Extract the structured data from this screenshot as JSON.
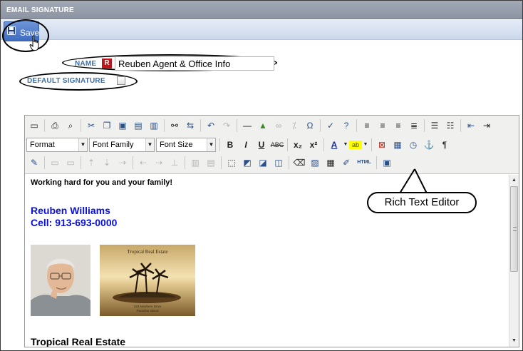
{
  "window": {
    "title": "EMAIL SIGNATURE"
  },
  "toolbar": {
    "save_label": "Save",
    "save_icon": "floppy-disk-icon"
  },
  "form": {
    "name_label": "NAME",
    "required_badge": "R",
    "name_value": "Reuben Agent & Office Info",
    "default_label": "DEFAULT SIGNATURE",
    "default_checked": false
  },
  "editor": {
    "format_label": "Format",
    "font_family_label": "Font Family",
    "font_size_label": "Font Size",
    "html_label": "HTML",
    "content": {
      "tagline": "Working hard for you and your family!",
      "agent_name": "Reuben Williams",
      "agent_cell": "Cell: 913-693-0000",
      "company": "Tropical Real Estate",
      "logo_title": "Tropical Real Estate",
      "logo_caption_1": "123 Nowhere Drive",
      "logo_caption_2": "Paradise Island"
    }
  },
  "annotation": {
    "rte_label": "Rich Text Editor"
  },
  "colors": {
    "title_bar": "#969dab",
    "save_button": "#4f7cc9",
    "label_blue": "#3e6fa8",
    "required_red": "#c0141b",
    "signature_blue": "#0a10d6"
  }
}
